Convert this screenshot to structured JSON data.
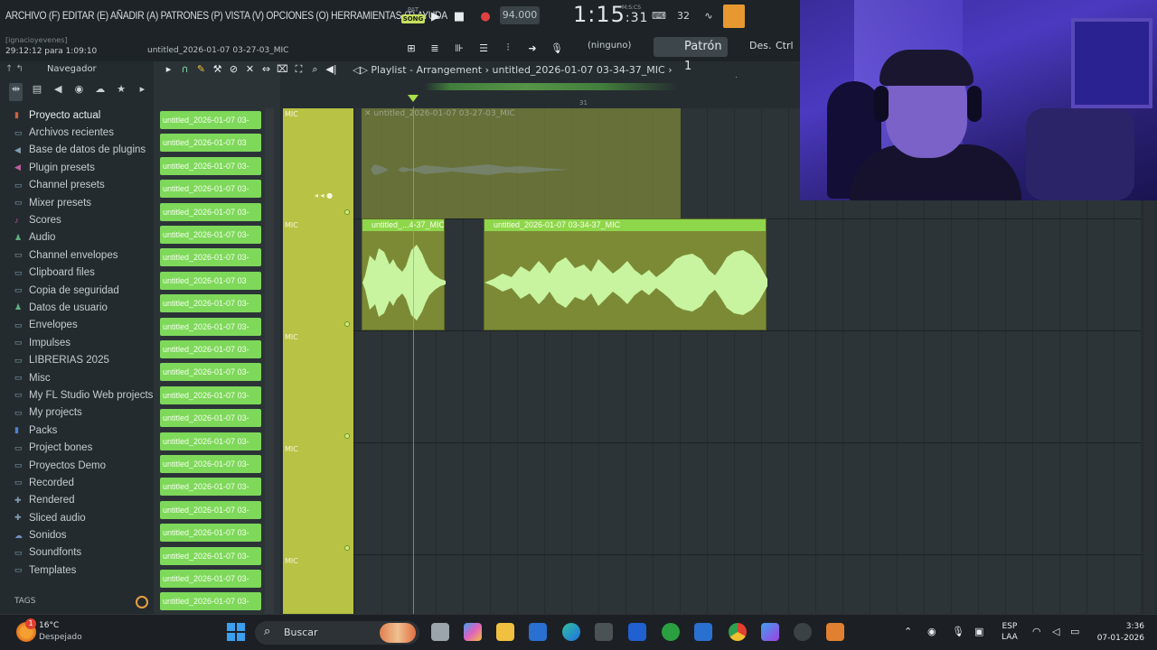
{
  "menu": "ARCHIVO (F) EDITAR (E) AÑADIR (A) PATRONES (P) VISTA (V) OPCIONES (O) HERRAMIENTAS (T) AYUDA",
  "transport": {
    "pat": "PAT",
    "song": "SONG",
    "tempo": "94.000",
    "clock_main": "1:15",
    "clock_small": ":31",
    "clock_unit": "M:S:CS"
  },
  "toolbar_icons": [
    "keyboard-icon",
    "32-icon",
    "wave-icon",
    "hint-icon"
  ],
  "status": {
    "user": "[ignacioyevenes]",
    "time_used": "29:12:12 para 1:09:10",
    "project_file": "untitled_2026-01-07 03-27-03_MIC"
  },
  "pattern": {
    "none_label": "(ninguno)",
    "pattern_name": "Patrón 1",
    "plus": "+",
    "des": "Des.",
    "ctrl": "Ctrl"
  },
  "browser": {
    "title": "Navegador",
    "items": [
      {
        "label": "Proyecto actual",
        "selected": true
      },
      {
        "label": "Archivos recientes"
      },
      {
        "label": "Base de datos de plugins"
      },
      {
        "label": "Plugin presets"
      },
      {
        "label": "Channel presets"
      },
      {
        "label": "Mixer presets"
      },
      {
        "label": "Scores"
      },
      {
        "label": "Audio"
      },
      {
        "label": "Channel envelopes"
      },
      {
        "label": "Clipboard files"
      },
      {
        "label": "Copia de seguridad"
      },
      {
        "label": "Datos de usuario"
      },
      {
        "label": "Envelopes"
      },
      {
        "label": "Impulses"
      },
      {
        "label": "LIBRERIAS 2025"
      },
      {
        "label": "Misc"
      },
      {
        "label": "My FL Studio Web projects"
      },
      {
        "label": "My projects"
      },
      {
        "label": "Packs"
      },
      {
        "label": "Project bones"
      },
      {
        "label": "Proyectos Demo"
      },
      {
        "label": "Recorded"
      },
      {
        "label": "Rendered"
      },
      {
        "label": "Sliced audio"
      },
      {
        "label": "Sonidos"
      },
      {
        "label": "Soundfonts"
      },
      {
        "label": "Templates"
      }
    ],
    "tags": "TAGS"
  },
  "channels": [
    "untitled_2026-01-07 03-",
    "untitled_2026-01-07 03",
    "untitled_2026-01-07 03-",
    "untitled_2026-01-07 03-",
    "untitled_2026-01-07 03-",
    "untitled_2026-01-07 03-",
    "untitled_2026-01-07 03-",
    "untitled_2026-01-07 03",
    "untitled_2026-01-07 03-",
    "untitled_2026-01-07 03-",
    "untitled_2026-01-07 03-",
    "untitled_2026-01-07 03-",
    "untitled_2026-01-07 03-",
    "untitled_2026-01-07 03-",
    "untitled_2026-01-07 03-",
    "untitled_2026-01-07 03-",
    "untitled_2026-01-07 03-",
    "untitled_2026-01-07 03-",
    "untitled_2026-01-07 03-",
    "untitled_2026-01-07 03-",
    "untitled_2026-01-07 03-",
    "untitled_2026-01-07 03-"
  ],
  "playlist": {
    "title": "Playlist - Arrangement",
    "arrangement": "untitled_2026-01-07 03-34-37_MIC",
    "bar_marker": "31",
    "tracks": [
      "MIC",
      "MIC",
      "MIC",
      "MIC",
      "MIC"
    ],
    "ghost_clip_label": "untitled_2026-01-07 03-27-03_MIC",
    "clips": [
      {
        "label": "untitled_...4-37_MIC"
      },
      {
        "label": "untitled_2026-01-07 03-34-37_MIC"
      }
    ]
  },
  "taskbar": {
    "weather_temp": "16°C",
    "weather_cond": "Despejado",
    "weather_badge": "1",
    "search": "Buscar",
    "lang1": "ESP",
    "lang2": "LAA",
    "time": "3:36",
    "date": "07-01-2026"
  },
  "colors": {
    "accent_green": "#7ed85a",
    "track_yellow": "#b8c244",
    "song_mode": "#c8e060"
  }
}
